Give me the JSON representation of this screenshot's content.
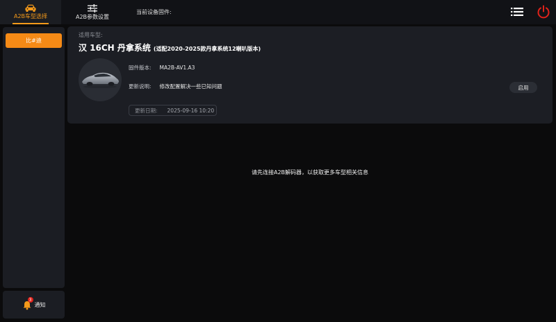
{
  "topbar": {
    "vehicle_tab_label": "A2B车型选择",
    "params_tab_label": "A2B参数设置",
    "firmware_label": "当前设备固件:"
  },
  "sidebar": {
    "filter_label": "比#迪"
  },
  "notify": {
    "badge": "3",
    "label": "通知"
  },
  "card": {
    "applicable_label": "适用车型:",
    "model_title": "汉 16CH 丹拿系统",
    "model_subtitle": "(适配2020-2025款丹拿系统12喇叭版本)",
    "firmware_label": "固件版本:",
    "firmware_value": "MA2B-AV1.A3",
    "note_label": "更新说明:",
    "note_value": "修改配置解决一些已知问题",
    "date_label": "更新日期:",
    "date_value": "2025-09-16 10:20",
    "enable_label": "启用"
  },
  "center_message": "请先连接A2B解码器，以获取更多车型相关信息",
  "colors": {
    "accent": "#f58a16",
    "power": "#e0221a",
    "card_bg": "#1c1e24"
  },
  "icons": {
    "vehicle_tab": "car-icon",
    "params_tab": "sliders-icon",
    "menu": "list-icon",
    "power": "power-icon",
    "notify": "bell-icon"
  }
}
